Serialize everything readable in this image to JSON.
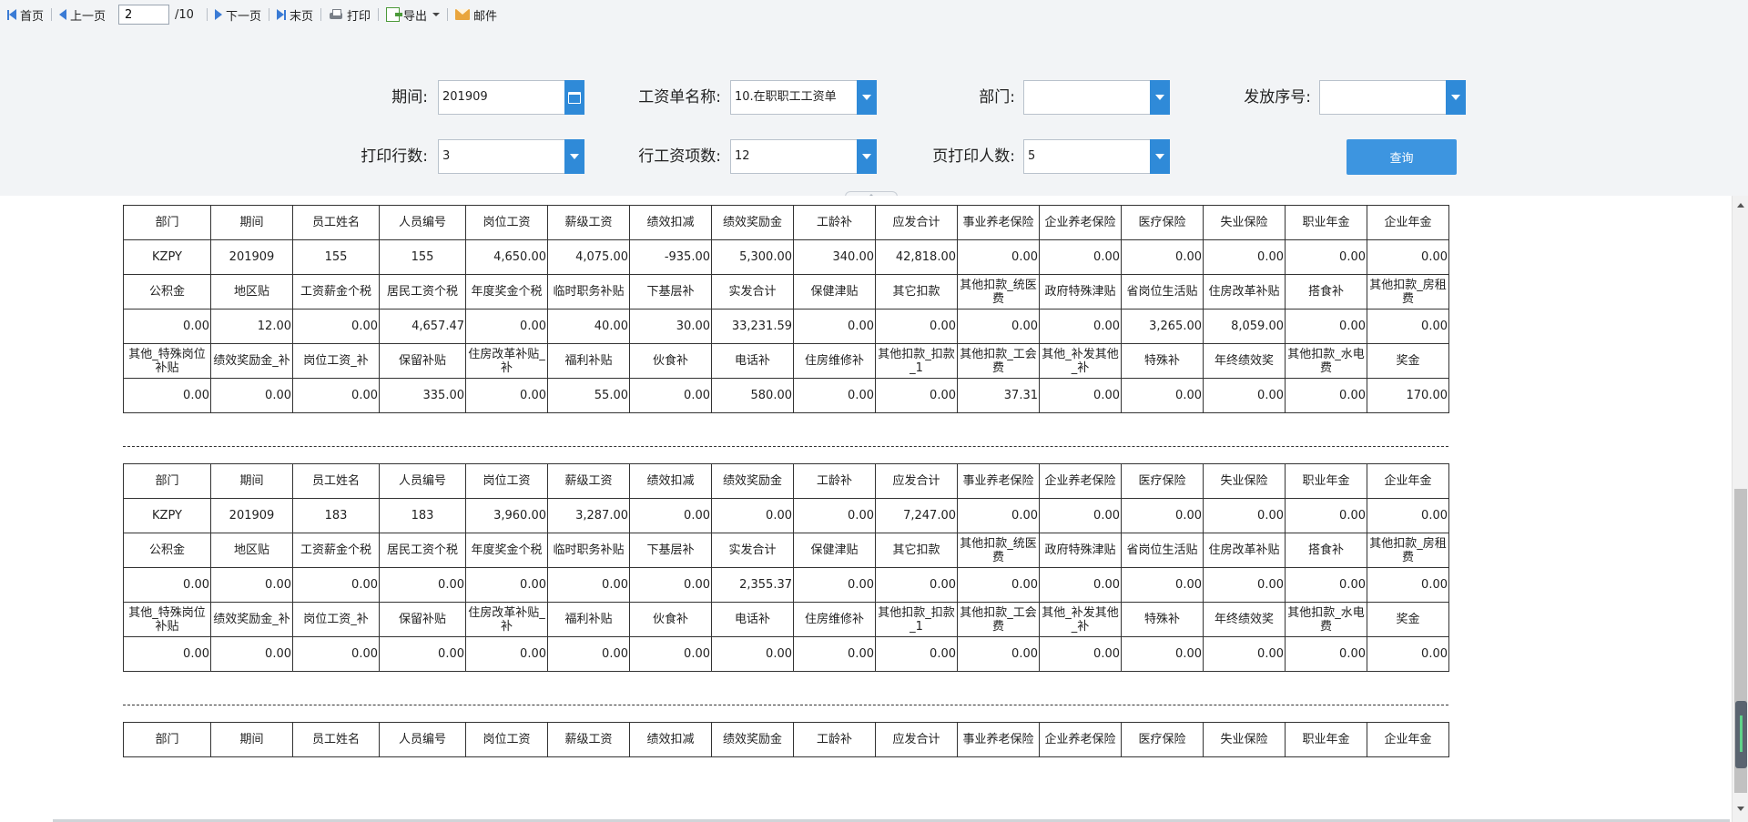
{
  "toolbar": {
    "first_label": "首页",
    "prev_label": "上一页",
    "page_value": "2",
    "page_total": "/10",
    "next_label": "下一页",
    "last_label": "末页",
    "print_label": "打印",
    "export_label": "导出",
    "mail_label": "邮件"
  },
  "filter": {
    "period_label": "期间:",
    "period_value": "201909",
    "payroll_label": "工资单名称:",
    "payroll_value": "10.在职职工工资单",
    "dept_label": "部门:",
    "dept_value": "",
    "seq_label": "发放序号:",
    "seq_value": "",
    "rows_label": "打印行数:",
    "rows_value": "3",
    "items_label": "行工资项数:",
    "items_value": "12",
    "persons_label": "页打印人数:",
    "persons_value": "5",
    "query_label": "查询"
  },
  "headers": [
    [
      "部门",
      "期间",
      "员工姓名",
      "人员编号",
      "岗位工资",
      "薪级工资",
      "绩效扣减",
      "绩效奖励金",
      "工龄补",
      "应发合计",
      "事业养老保险",
      "企业养老保险",
      "医疗保险",
      "失业保险",
      "职业年金",
      "企业年金"
    ],
    [
      "公积金",
      "地区贴",
      "工资薪金个税",
      "居民工资个税",
      "年度奖金个税",
      "临时职务补贴",
      "下基层补",
      "实发合计",
      "保健津贴",
      "其它扣款",
      "其他扣款_统医费",
      "政府特殊津贴",
      "省岗位生活贴",
      "住房改革补贴",
      "搭食补",
      "其他扣款_房租费"
    ],
    [
      "其他_特殊岗位补贴",
      "绩效奖励金_补",
      "岗位工资_补",
      "保留补贴",
      "住房改革补贴_补",
      "福利补贴",
      "伙食补",
      "电话补",
      "住房维修补",
      "其他扣款_扣款_1",
      "其他扣款_工会费",
      "其他_补发其他_补",
      "特殊补",
      "年终绩效奖",
      "其他扣款_水电费",
      "奖金"
    ]
  ],
  "records": [
    {
      "rows": [
        [
          "KZPY",
          "201909",
          "155",
          "155",
          "4,650.00",
          "4,075.00",
          "-935.00",
          "5,300.00",
          "340.00",
          "42,818.00",
          "0.00",
          "0.00",
          "0.00",
          "0.00",
          "0.00",
          "0.00"
        ],
        [
          "0.00",
          "12.00",
          "0.00",
          "4,657.47",
          "0.00",
          "40.00",
          "30.00",
          "33,231.59",
          "0.00",
          "0.00",
          "0.00",
          "0.00",
          "3,265.00",
          "8,059.00",
          "0.00",
          "0.00"
        ],
        [
          "0.00",
          "0.00",
          "0.00",
          "335.00",
          "0.00",
          "55.00",
          "0.00",
          "580.00",
          "0.00",
          "0.00",
          "37.31",
          "0.00",
          "0.00",
          "0.00",
          "0.00",
          "170.00"
        ]
      ]
    },
    {
      "rows": [
        [
          "KZPY",
          "201909",
          "183",
          "183",
          "3,960.00",
          "3,287.00",
          "0.00",
          "0.00",
          "0.00",
          "7,247.00",
          "0.00",
          "0.00",
          "0.00",
          "0.00",
          "0.00",
          "0.00"
        ],
        [
          "0.00",
          "0.00",
          "0.00",
          "0.00",
          "0.00",
          "0.00",
          "0.00",
          "2,355.37",
          "0.00",
          "0.00",
          "0.00",
          "0.00",
          "0.00",
          "0.00",
          "0.00",
          "0.00"
        ],
        [
          "0.00",
          "0.00",
          "0.00",
          "0.00",
          "0.00",
          "0.00",
          "0.00",
          "0.00",
          "0.00",
          "0.00",
          "0.00",
          "0.00",
          "0.00",
          "0.00",
          "0.00",
          "0.00"
        ]
      ]
    },
    {
      "rows": []
    }
  ]
}
